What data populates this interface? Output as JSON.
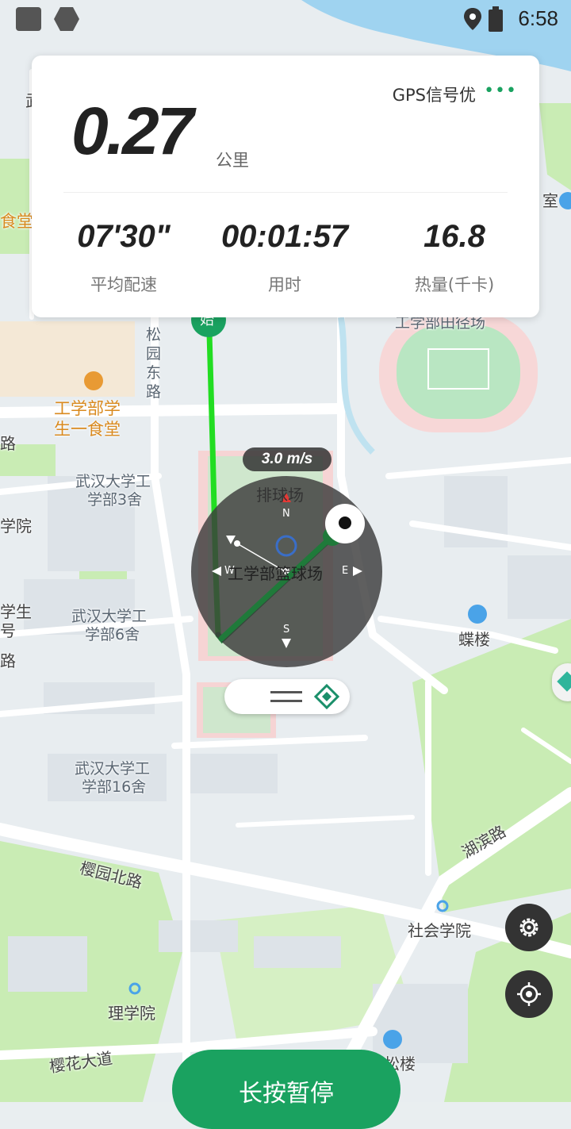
{
  "status_bar": {
    "time": "6:58"
  },
  "stats_card": {
    "distance_value": "0.27",
    "distance_unit": "公里",
    "gps_status": "GPS信号优",
    "more_label": "•••",
    "pace_value": "07'30\"",
    "pace_label": "平均配速",
    "duration_value": "00:01:57",
    "duration_label": "用时",
    "calories_value": "16.8",
    "calories_label": "热量(千卡)"
  },
  "compass": {
    "speed": "3.0 m/s",
    "north": "N",
    "south": "S",
    "west": "W",
    "east": "E"
  },
  "map_labels": {
    "start_marker": "始",
    "canteen_1": "工学部学",
    "canteen_2": "生一食堂",
    "food_edge": "食堂",
    "song_road": "松园东路",
    "dorm3_1": "武汉大学工",
    "dorm3_2": "学部3舍",
    "dorm6_1": "武汉大学工",
    "dorm6_2": "学部6舍",
    "dorm16_1": "武汉大学工",
    "dorm16_2": "学部16舍",
    "volleyball": "排球场",
    "basketball": "工学部篮球场",
    "field": "工学部田径场",
    "dielou": "蝶楼",
    "yingyuan_road": "樱园北路",
    "hubin_road": "湖滨路",
    "sociology": "社会学院",
    "science": "理学院",
    "yinghua_road": "樱花大道",
    "songlou": "松楼",
    "room_edge": "室",
    "wu_edge": "武",
    "xueyuan_edge": "学院",
    "xuesheng_edge": "学生",
    "hao_edge": "号",
    "lu_edge1": "路",
    "lu_edge2": "路"
  },
  "controls": {
    "settings_icon": "gear-icon",
    "locate_icon": "crosshair-icon",
    "pause_label": "长按暂停"
  },
  "colors": {
    "accent": "#1aa260",
    "track": "#22dd22",
    "track_dark": "#1f7a3a"
  }
}
